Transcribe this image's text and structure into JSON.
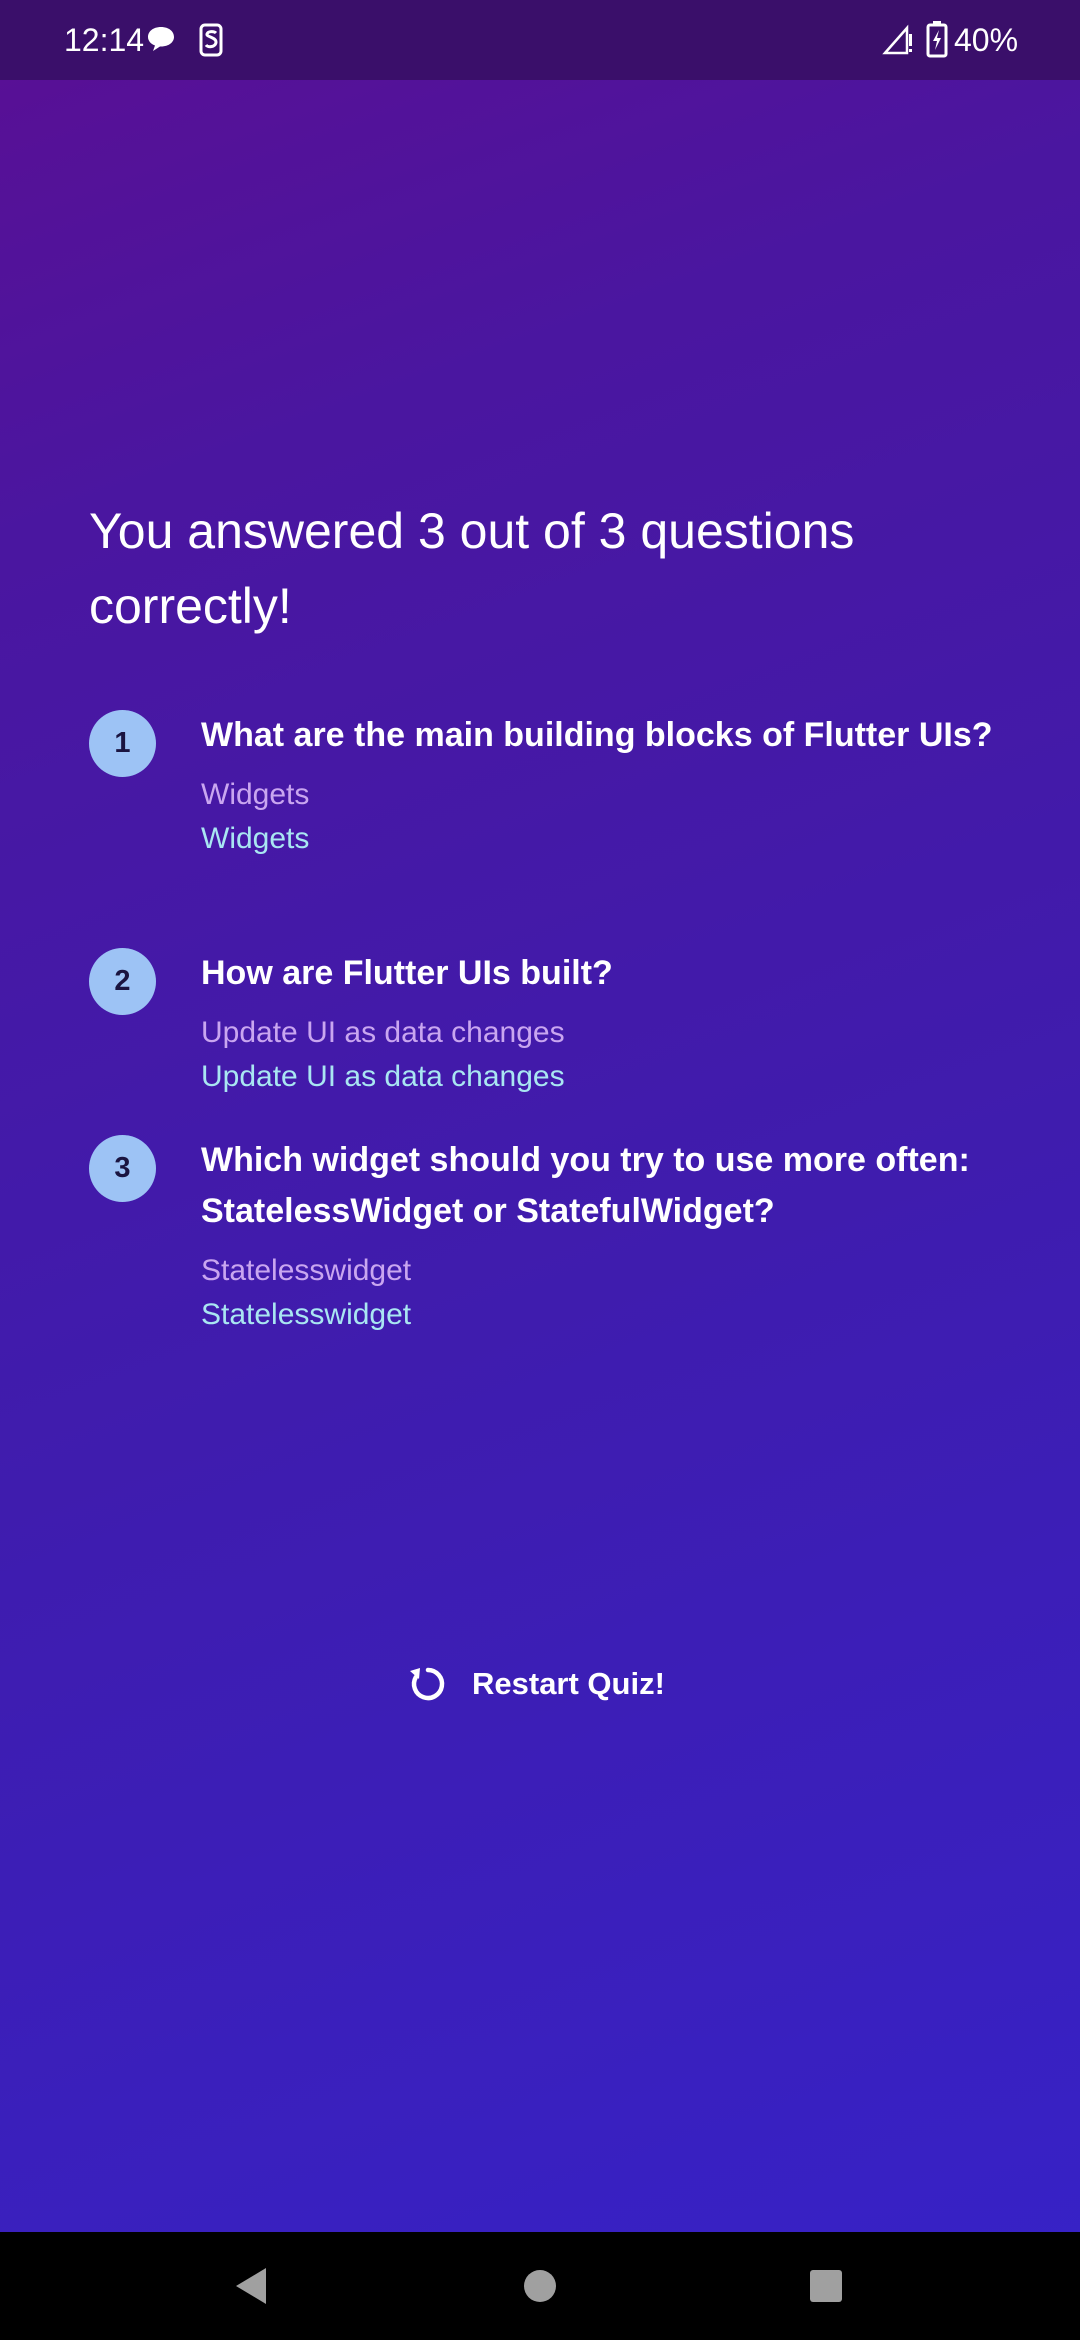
{
  "status_bar": {
    "time": "12:14",
    "battery": "40%",
    "icons": [
      "message-icon",
      "s-app-icon",
      "signal-icon",
      "battery-icon"
    ]
  },
  "summary": {
    "title": "You answered 3 out of 3 questions correctly!"
  },
  "questions": [
    {
      "index": "1",
      "question": "What are the main building blocks of Flutter UIs?",
      "user_answer": "Widgets",
      "correct_answer": "Widgets"
    },
    {
      "index": "2",
      "question": "How are Flutter UIs built?",
      "user_answer": "Update UI as data changes",
      "correct_answer": "Update UI as data changes"
    },
    {
      "index": "3",
      "question": "Which widget should you try to use more often: StatelessWidget or StatefulWidget?",
      "user_answer": "Statelesswidget",
      "correct_answer": "Statelesswidget"
    }
  ],
  "restart": {
    "label": "Restart Quiz!",
    "icon": "restart-icon"
  },
  "colors": {
    "badge": "#9dc3f5",
    "user_answer": "#c9a6f0",
    "correct_answer": "#a9e6f2",
    "background_top": "#5a0f94",
    "background_bottom": "#3622c8"
  }
}
